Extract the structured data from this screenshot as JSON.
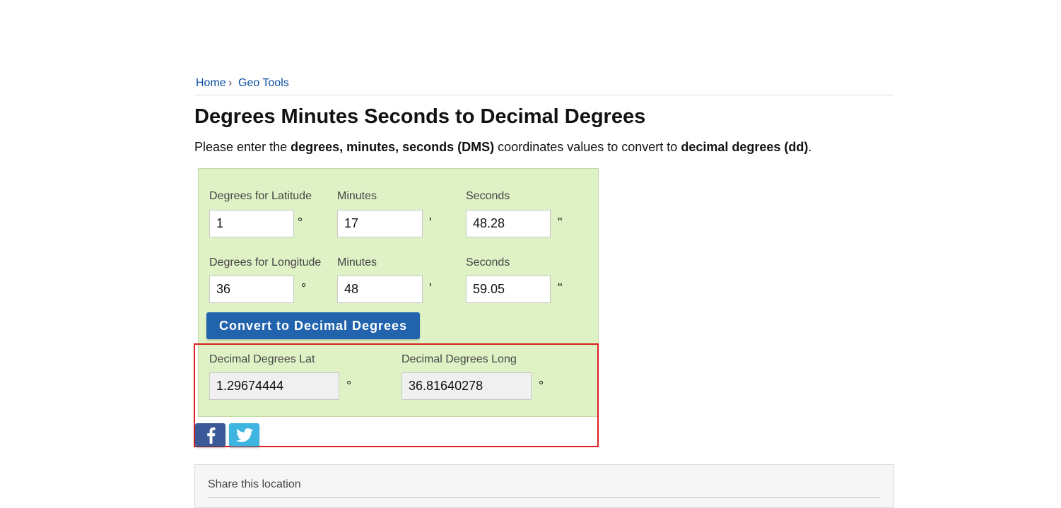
{
  "breadcrumb": {
    "home": "Home",
    "separator": "›",
    "geo_tools": "Geo Tools"
  },
  "page": {
    "title": "Degrees Minutes Seconds to Decimal Degrees",
    "intro": {
      "p1": "Please enter the ",
      "b1": "degrees, minutes, seconds (DMS)",
      "p2": " coordinates values to convert to ",
      "b2": "decimal degrees (dd)",
      "p3": "."
    }
  },
  "latitude": {
    "degrees_label": "Degrees for Latitude",
    "degrees_value": "1",
    "degrees_unit": "°",
    "minutes_label": "Minutes",
    "minutes_value": "17",
    "minutes_unit": "'",
    "seconds_label": "Seconds",
    "seconds_value": "48.28",
    "seconds_unit": "\""
  },
  "longitude": {
    "degrees_label": "Degrees for Longitude",
    "degrees_value": "36",
    "degrees_unit": "°",
    "minutes_label": "Minutes",
    "minutes_value": "48",
    "minutes_unit": "'",
    "seconds_label": "Seconds",
    "seconds_value": "59.05",
    "seconds_unit": "\""
  },
  "convert_button": "Convert to Decimal Degrees",
  "result": {
    "lat_label": "Decimal Degrees Lat",
    "lat_value": "1.29674444",
    "lat_unit": "°",
    "long_label": "Decimal Degrees Long",
    "long_value": "36.81640278",
    "long_unit": "°"
  },
  "share": {
    "facebook_icon": "facebook-icon",
    "twitter_icon": "twitter-icon"
  },
  "share_panel": {
    "title": "Share this location"
  },
  "colors": {
    "panel_bg": "#dff2c6",
    "button": "#2163ad",
    "highlight": "#d91f1f",
    "facebook": "#3b5998",
    "twitter": "#3eb5e0",
    "link": "#0b4ea2"
  }
}
